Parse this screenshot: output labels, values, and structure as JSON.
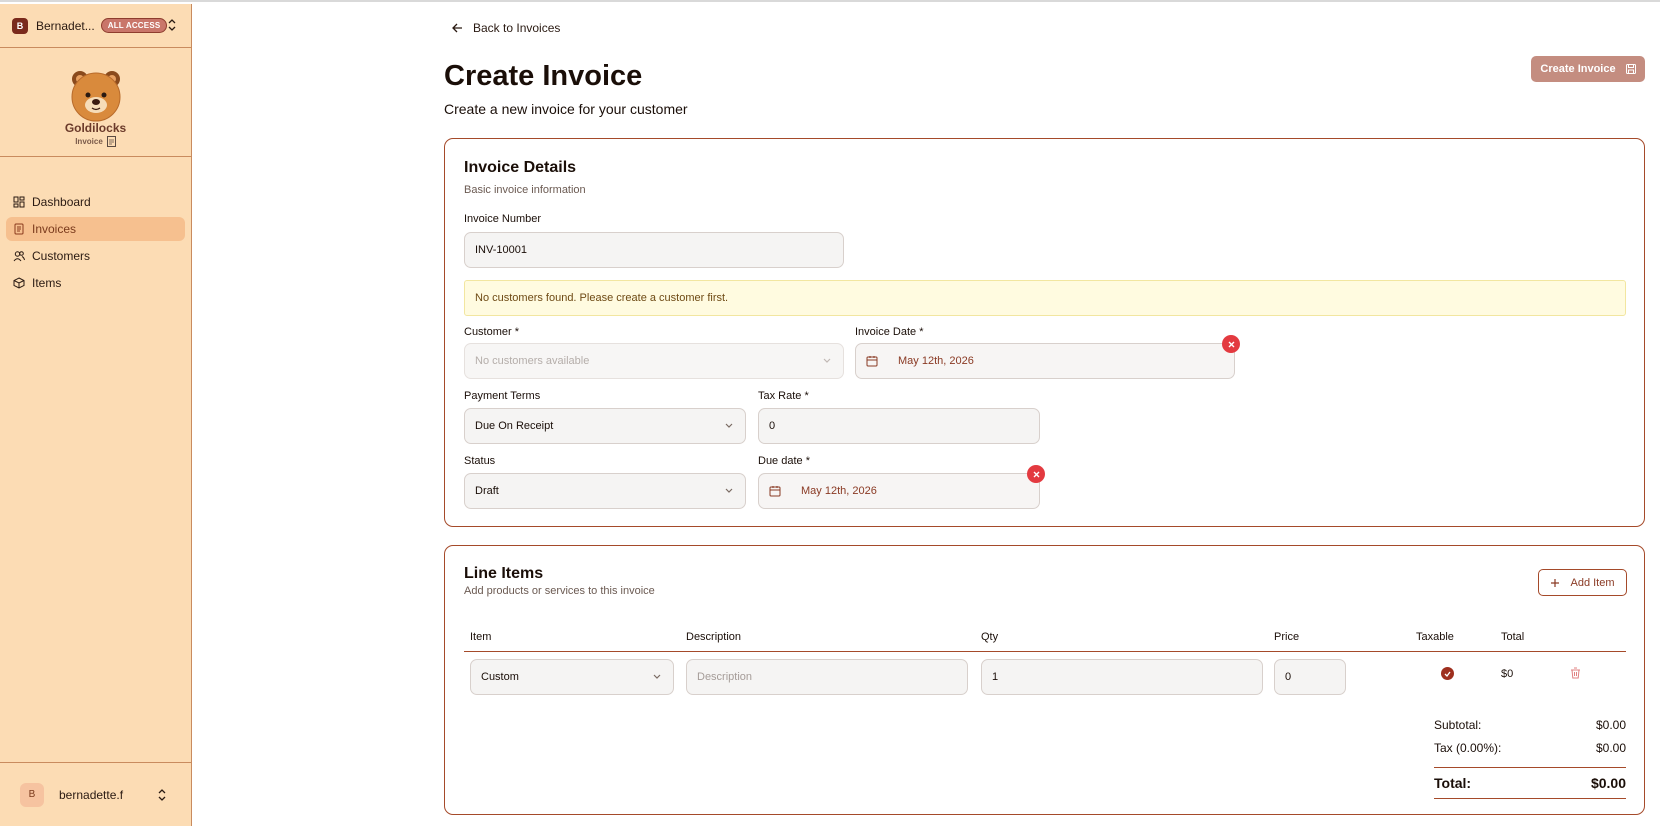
{
  "sidebar": {
    "team": {
      "avatar": "B",
      "name": "Bernadet...",
      "badge": "ALL ACCESS"
    },
    "logo": {
      "title": "Goldilocks",
      "subtitle": "Invoice"
    },
    "items": [
      {
        "label": "Dashboard",
        "icon": "dashboard-icon",
        "active": false
      },
      {
        "label": "Invoices",
        "icon": "invoice-icon",
        "active": true
      },
      {
        "label": "Customers",
        "icon": "users-icon",
        "active": false
      },
      {
        "label": "Items",
        "icon": "package-icon",
        "active": false
      }
    ],
    "user": {
      "avatar": "B",
      "name": "bernadette.f"
    }
  },
  "header": {
    "back_label": "Back to Invoices",
    "title": "Create Invoice",
    "subtitle": "Create a new invoice for your customer",
    "create_button": "Create Invoice"
  },
  "details": {
    "title": "Invoice Details",
    "description": "Basic invoice information",
    "invoice_number_label": "Invoice Number",
    "invoice_number_value": "INV-10001",
    "alert": "No customers found. Please create a customer first.",
    "customer_label": "Customer *",
    "customer_placeholder": "No customers available",
    "invoice_date_label": "Invoice Date *",
    "invoice_date_value": "May 12th, 2026",
    "payment_terms_label": "Payment Terms",
    "payment_terms_value": "Due On Receipt",
    "tax_rate_label": "Tax Rate *",
    "tax_rate_value": "0",
    "status_label": "Status",
    "status_value": "Draft",
    "due_date_label": "Due date *",
    "due_date_value": "May 12th, 2026"
  },
  "line_items": {
    "title": "Line Items",
    "description": "Add products or services to this invoice",
    "add_button": "Add Item",
    "columns": [
      "Item",
      "Description",
      "Qty",
      "Price",
      "Taxable",
      "Total"
    ],
    "rows": [
      {
        "item": "Custom",
        "description_placeholder": "Description",
        "qty": "1",
        "price": "0",
        "taxable": true,
        "total": "$0"
      }
    ],
    "subtotal_label": "Subtotal:",
    "subtotal_value": "$0.00",
    "tax_label": "Tax (0.00%):",
    "tax_value": "$0.00",
    "total_label": "Total:",
    "total_value": "$0.00"
  },
  "colors": {
    "sidebar_bg": "#fcdcb4",
    "accent": "#a54a2a",
    "active_nav": "#f6c08f",
    "danger": "#e33a40",
    "primary_button": "#c48d80"
  }
}
